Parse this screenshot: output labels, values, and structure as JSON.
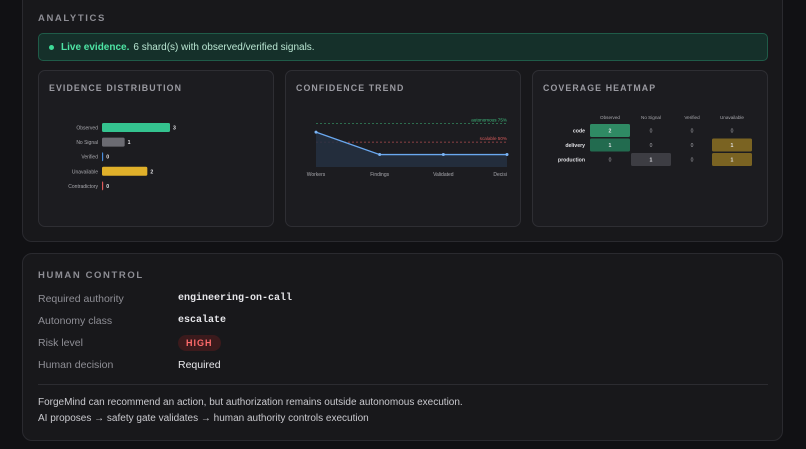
{
  "analytics": {
    "title": "ANALYTICS",
    "banner": {
      "strong": "Live evidence.",
      "text": "6 shard(s) with observed/verified signals."
    },
    "distribution": {
      "title": "EVIDENCE DISTRIBUTION",
      "colors": {
        "observed": "#34c38f",
        "no_signal": "#6b6b72",
        "verified": "#4a8fe0",
        "unavailable": "#e0b02a",
        "contradictory": "#e05b5b"
      }
    },
    "trend": {
      "title": "CONFIDENCE TREND",
      "ref_autonomous": "autonomous 75%",
      "ref_scalable": "scalable 50%"
    },
    "heatmap": {
      "title": "COVERAGE HEATMAP",
      "columns": [
        "Observed",
        "No Signal",
        "Verified",
        "Unavailable"
      ],
      "rows": [
        {
          "label": "code",
          "cells": [
            "2",
            "0",
            "0",
            "0"
          ]
        },
        {
          "label": "delivery",
          "cells": [
            "1",
            "0",
            "0",
            "1"
          ]
        },
        {
          "label": "production",
          "cells": [
            "0",
            "1",
            "0",
            "1"
          ]
        }
      ]
    }
  },
  "chart_data": [
    {
      "type": "bar",
      "orientation": "horizontal",
      "title": "EVIDENCE DISTRIBUTION",
      "categories": [
        "Observed",
        "No Signal",
        "Verified",
        "Unavailable",
        "Contradictory"
      ],
      "values": [
        3,
        1,
        0,
        2,
        0
      ]
    },
    {
      "type": "line",
      "title": "CONFIDENCE TREND",
      "x": [
        "Workers",
        "Findings",
        "Validated",
        "Decisi"
      ],
      "series": [
        {
          "values": [
            0.68,
            0.5,
            0.5,
            0.5
          ]
        }
      ],
      "reference_lines": [
        {
          "label": "autonomous 75%",
          "value": 0.75
        },
        {
          "label": "scalable 50%",
          "value": 0.6
        }
      ],
      "ylim": [
        0.4,
        0.85
      ]
    },
    {
      "type": "heatmap",
      "title": "COVERAGE HEATMAP",
      "columns": [
        "Observed",
        "No Signal",
        "Verified",
        "Unavailable"
      ],
      "rows": [
        "code",
        "delivery",
        "production"
      ],
      "values": [
        [
          2,
          0,
          0,
          0
        ],
        [
          1,
          0,
          0,
          1
        ],
        [
          0,
          1,
          0,
          1
        ]
      ]
    }
  ],
  "human_control": {
    "title": "HUMAN CONTROL",
    "rows": [
      {
        "label": "Required authority",
        "value": "engineering-on-call"
      },
      {
        "label": "Autonomy class",
        "value": "escalate"
      },
      {
        "label": "Risk level",
        "value": "HIGH"
      },
      {
        "label": "Human decision",
        "value": "Required"
      }
    ],
    "note_line1": "ForgeMind can recommend an action, but authorization remains outside autonomous execution.",
    "note_line2": "AI proposes → safety gate validates → human authority controls execution"
  }
}
